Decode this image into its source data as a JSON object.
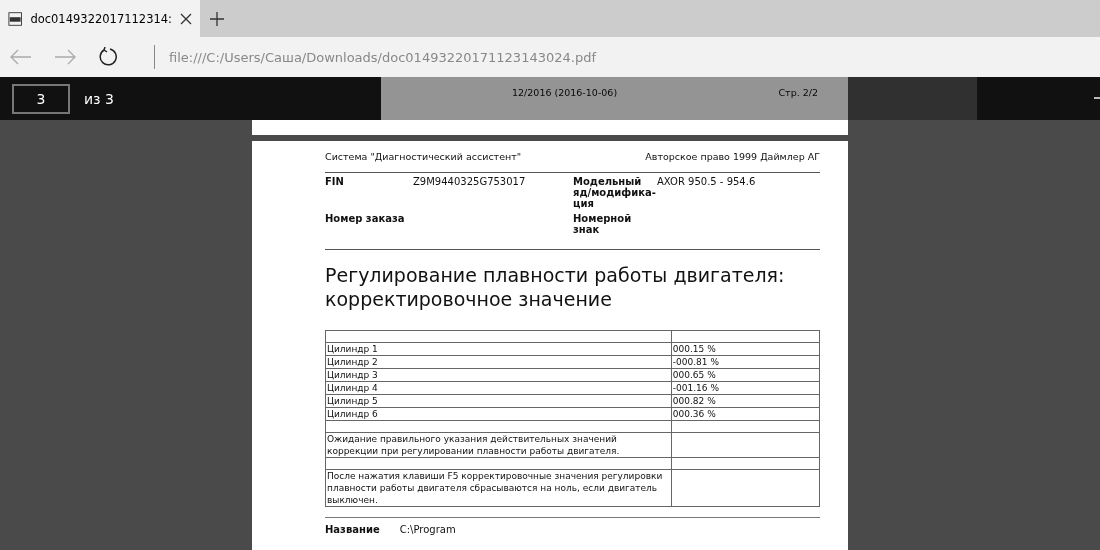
{
  "browser": {
    "tab": {
      "title": "doc0149322017112314:"
    },
    "address": "file:///C:/Users/Саша/Downloads/doc01493220171123143024.pdf"
  },
  "pdf_toolbar": {
    "page_input": "3",
    "page_total": "из 3"
  },
  "previous_page": {
    "footer_center": "12/2016 (2016-10-06)",
    "footer_right": "Стр. 2/2"
  },
  "page": {
    "header_left": "Система \"Диагностический ассистент\"",
    "header_right": "Авторское право 1999 Даймлер АГ",
    "info": [
      {
        "label": "FIN",
        "value": "Z9M9440325G753017",
        "label2": "Модельный яд/модифика-ция",
        "value2": "AXOR 950.5 - 954.6"
      },
      {
        "label": "Номер заказа",
        "label2": "Номерной знак"
      }
    ],
    "title": "Регулирование плавности работы двигателя: корректировочное значение",
    "table_rows": [
      {
        "column_1": "",
        "column_2": ""
      },
      {
        "column_1": "Цилиндр 1",
        "column_2": "000.15 %"
      },
      {
        "column_1": "Цилиндр 2",
        "column_2": "-000.81 %"
      },
      {
        "column_1": "Цилиндр 3",
        "column_2": "000.65 %"
      },
      {
        "column_1": "Цилиндр 4",
        "column_2": "-001.16 %"
      },
      {
        "column_1": "Цилиндр 5",
        "column_2": "000.82 %"
      },
      {
        "column_1": "Цилиндр 6",
        "column_2": "000.36 %"
      },
      {
        "column_1": "",
        "column_2": ""
      },
      {
        "column_1": "Ожидание правильного указания действительных значений коррекции при регулировании плавности работы двигателя.",
        "column_2": ""
      },
      {
        "column_1": "",
        "column_2": ""
      },
      {
        "column_1": "После нажатия клавиши F5 корректировочные значения регулировки плавности работы двигателя сбрасываются на ноль, если двигатель выключен.",
        "column_2": ""
      }
    ],
    "footer_label": "Название",
    "footer_value": "C:\\Program"
  }
}
